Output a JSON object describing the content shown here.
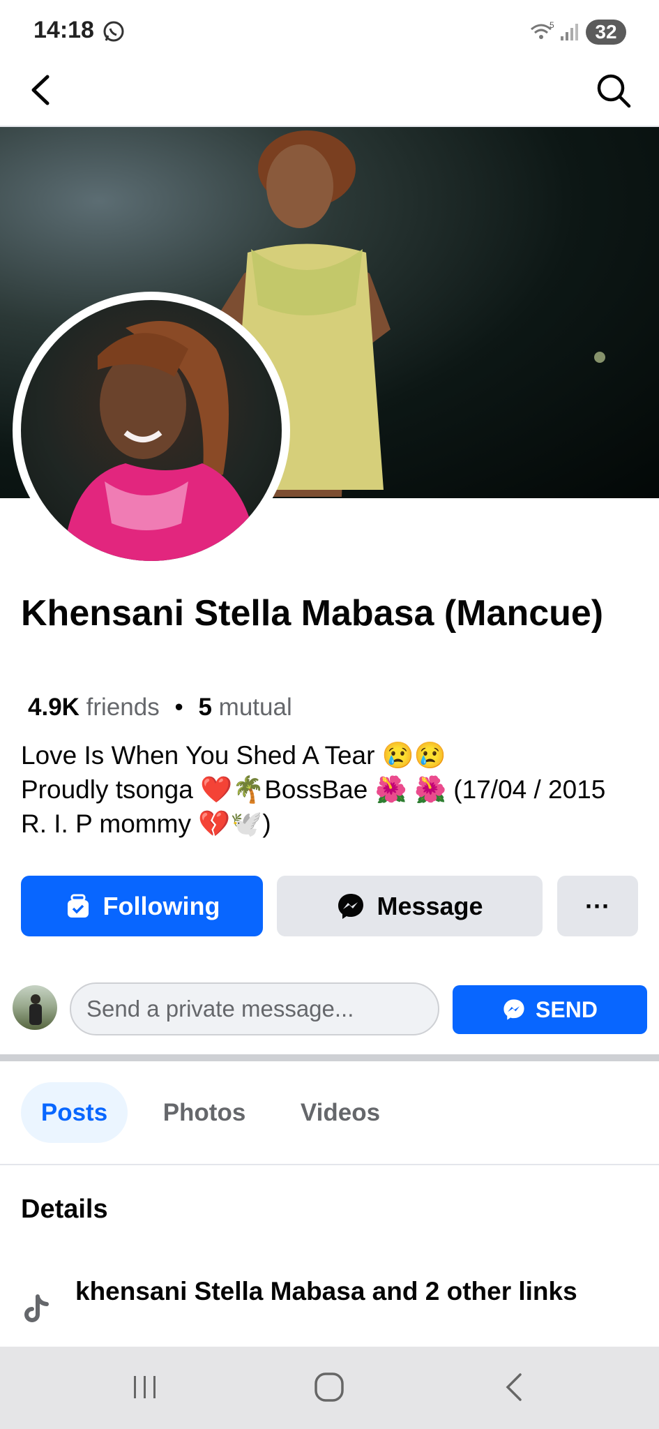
{
  "status_bar": {
    "time": "14:18",
    "battery": "32",
    "wifi_badge": "5"
  },
  "profile": {
    "name": "Khensani Stella Mabasa (Mancue)",
    "friends_count": "4.9K",
    "friends_label": "friends",
    "separator": "•",
    "mutual_count": "5",
    "mutual_label": "mutual",
    "bio_line1": "Love Is When You Shed A Tear 😢😢",
    "bio_line2": "Proudly tsonga ❤️🌴BossBae 🌺 🌺 (17/04 / 2015 R. I. P mommy 💔🕊️)"
  },
  "actions": {
    "following_label": "Following",
    "message_label": "Message",
    "more_label": "···"
  },
  "private_message": {
    "placeholder": "Send a private message...",
    "send_label": "SEND"
  },
  "tabs": [
    {
      "label": "Posts",
      "active": true
    },
    {
      "label": "Photos",
      "active": false
    },
    {
      "label": "Videos",
      "active": false
    }
  ],
  "details": {
    "heading": "Details",
    "link_text": "khensani Stella Mabasa and 2 other links"
  },
  "colors": {
    "accent": "#0866ff",
    "button_gray": "#e4e6eb",
    "secondary_text": "#65676b"
  }
}
